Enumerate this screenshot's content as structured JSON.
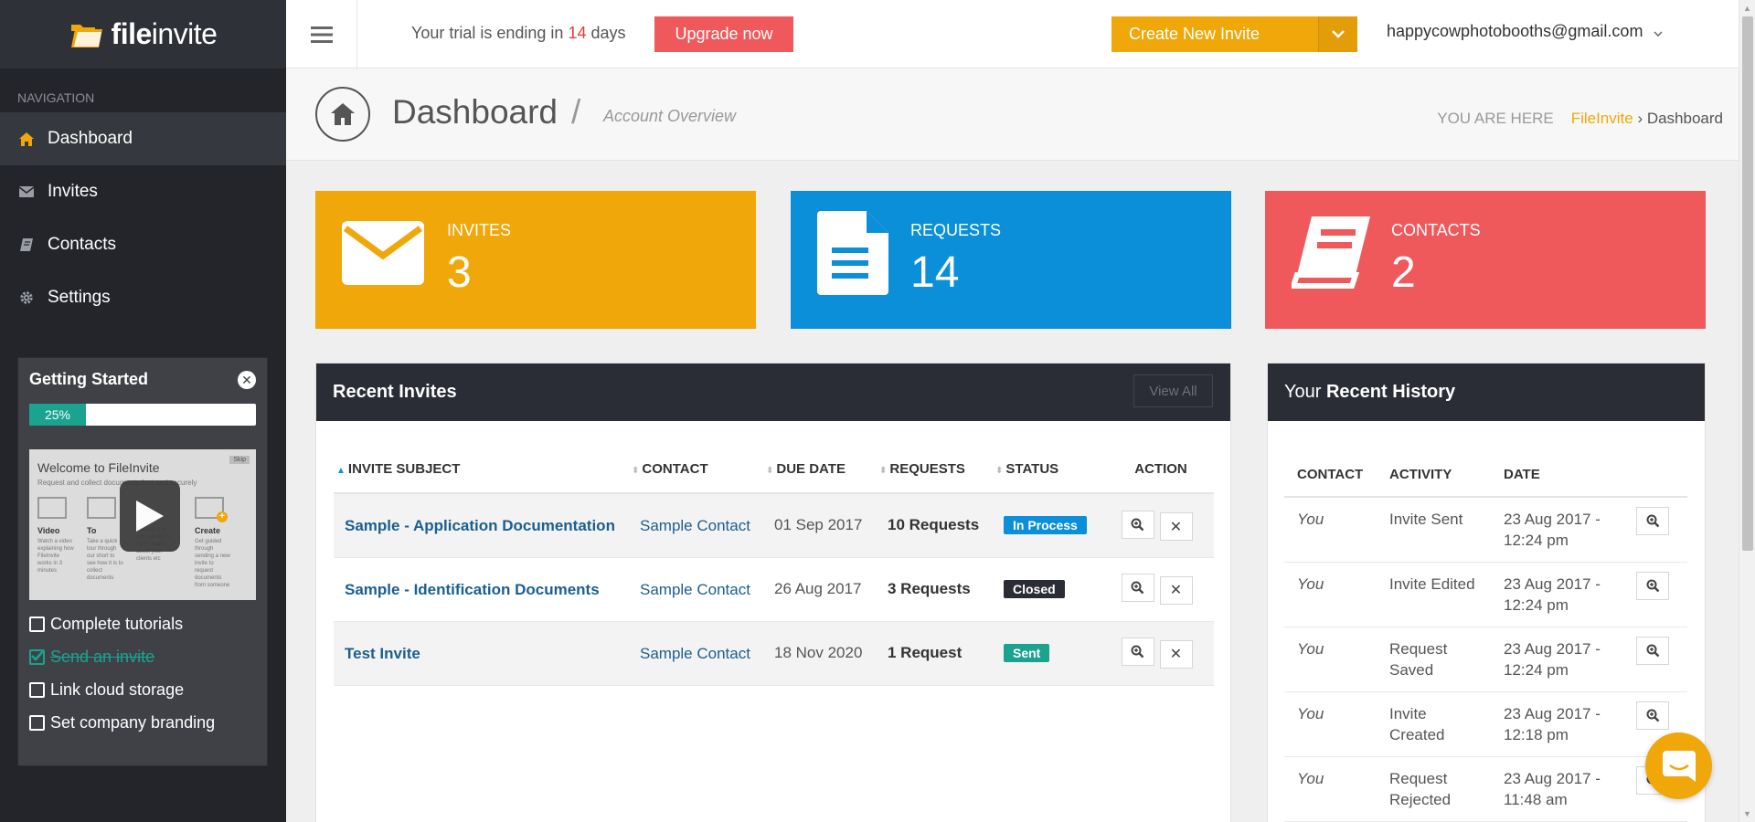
{
  "logo": {
    "part1": "file",
    "part2": "invite"
  },
  "sidebar": {
    "nav_heading": "NAVIGATION",
    "items": [
      {
        "label": "Dashboard",
        "icon": "home-icon",
        "active": true
      },
      {
        "label": "Invites",
        "icon": "envelope-icon"
      },
      {
        "label": "Contacts",
        "icon": "book-icon"
      },
      {
        "label": "Settings",
        "icon": "gear-icon"
      }
    ]
  },
  "getting_started": {
    "title": "Getting Started",
    "progress_label": "25%",
    "progress": 0.25,
    "video": {
      "title": "Welcome to FileInvite",
      "subtitle": "Request and collect documents fast and securely",
      "skip": "Skip",
      "cols": [
        {
          "label": "Video",
          "text": "Watch a video explaining how FileInvite works in 3 minutes"
        },
        {
          "label": "To",
          "text": "Take a quick tour through our short to see how it is to collect documents"
        },
        {
          "label": "",
          "text": "You can use our settings to input details about your clients etc"
        },
        {
          "label": "Create",
          "text": "Get guided through sending a new invite to request documents from someone"
        }
      ]
    },
    "tasks": [
      {
        "label": "Complete tutorials",
        "done": false
      },
      {
        "label": "Send an invite",
        "done": true
      },
      {
        "label": "Link cloud storage",
        "done": false
      },
      {
        "label": "Set company branding",
        "done": false
      }
    ]
  },
  "topbar": {
    "trial_prefix": "Your trial is ending in ",
    "trial_days": "14",
    "trial_suffix": " days",
    "upgrade": "Upgrade now",
    "create": "Create New Invite",
    "user": "happycowphotobooths@gmail.com"
  },
  "page_header": {
    "title": "Dashboard",
    "separator": "/",
    "subtitle": "Account Overview",
    "crumb_prefix": "YOU ARE HERE",
    "crumb_link": "FileInvite",
    "crumb_sep": " › ",
    "crumb_current": "Dashboard"
  },
  "stats": {
    "invites": {
      "label": "INVITES",
      "value": "3"
    },
    "requests": {
      "label": "REQUESTS",
      "value": "14"
    },
    "contacts": {
      "label": "CONTACTS",
      "value": "2"
    }
  },
  "recent_invites": {
    "title": "Recent Invites",
    "view_all": "View All",
    "columns": [
      "INVITE SUBJECT",
      "CONTACT",
      "DUE DATE",
      "REQUESTS",
      "STATUS",
      "ACTION"
    ],
    "rows": [
      {
        "subject": "Sample - Application Documentation",
        "contact": "Sample Contact",
        "due": "01 Sep 2017",
        "requests": "10 Requests",
        "status": "In Process",
        "status_color": "#0a8fd8"
      },
      {
        "subject": "Sample - Identification Documents",
        "contact": "Sample Contact",
        "due": "26 Aug 2017",
        "requests": "3 Requests",
        "status": "Closed",
        "status_color": "#2b2d36"
      },
      {
        "subject": "Test Invite",
        "contact": "Sample Contact",
        "due": "18 Nov 2020",
        "requests": "1 Request",
        "status": "Sent",
        "status_color": "#1aa38f"
      }
    ]
  },
  "recent_history": {
    "title_prefix": "Your ",
    "title_bold": "Recent History",
    "columns": [
      "CONTACT",
      "ACTIVITY",
      "DATE"
    ],
    "rows": [
      {
        "who": "You",
        "activity": "Invite Sent",
        "date": "23 Aug 2017 - 12:24 pm"
      },
      {
        "who": "You",
        "activity": "Invite Edited",
        "date": "23 Aug 2017 - 12:24 pm"
      },
      {
        "who": "You",
        "activity": "Request Saved",
        "date": "23 Aug 2017 - 12:24 pm"
      },
      {
        "who": "You",
        "activity": "Invite Created",
        "date": "23 Aug 2017 - 12:18 pm"
      },
      {
        "who": "You",
        "activity": "Request Rejected",
        "date": "23 Aug 2017 - 11:48 am"
      }
    ]
  },
  "colors": {
    "accent": "#f0a70a",
    "blue": "#0a8fd8",
    "red": "#f0595c",
    "teal": "#1aa38f",
    "dark": "#23252b"
  }
}
